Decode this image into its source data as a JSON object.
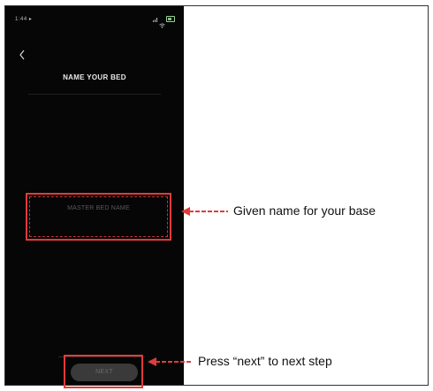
{
  "status_bar": {
    "time": "1:44 ▸",
    "icons": [
      "signal-icon",
      "wifi-icon",
      "battery-icon"
    ]
  },
  "header": {
    "back_icon": "chevron-left-icon",
    "title": "NAME YOUR BED"
  },
  "form": {
    "bed_name_placeholder": "MASTER BED NAME",
    "bed_name_value": ""
  },
  "footer": {
    "next_label": "NEXT"
  },
  "annotations": {
    "name_note": "Given name for your base",
    "next_note": "Press “next” to next step"
  },
  "colors": {
    "screen_background": "#060606",
    "highlight": "#e13b3b",
    "button_background": "#3a3a3a"
  }
}
